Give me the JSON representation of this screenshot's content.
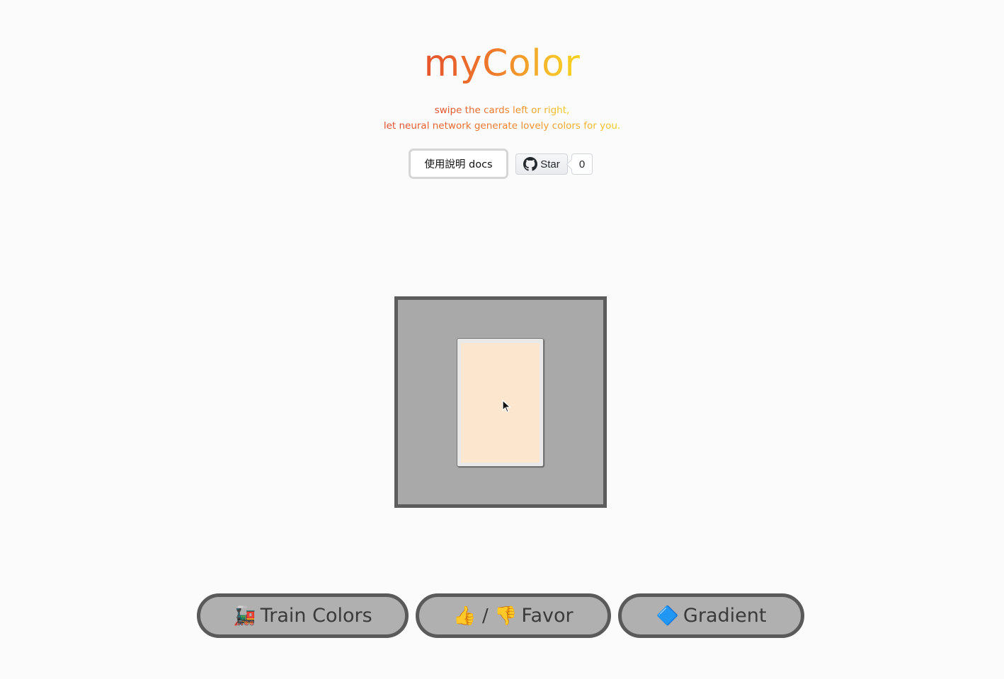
{
  "header": {
    "title": "myColor",
    "subtitle_line1": "swipe the cards left or right,",
    "subtitle_line2": "let neural network generate lovely colors for you."
  },
  "toolbar": {
    "docs_label": "使用說明 docs",
    "github_star_label": "Star",
    "github_star_count": "0"
  },
  "card": {
    "swatch_color": "#fce6cd",
    "stage_color": "#a9a9a9"
  },
  "actions": {
    "train": {
      "icon": "🚂",
      "label": "Train Colors"
    },
    "favor": {
      "icon": "👍 / 👎",
      "label": "Favor"
    },
    "gradient": {
      "icon": "🔷",
      "label": "Gradient"
    }
  }
}
